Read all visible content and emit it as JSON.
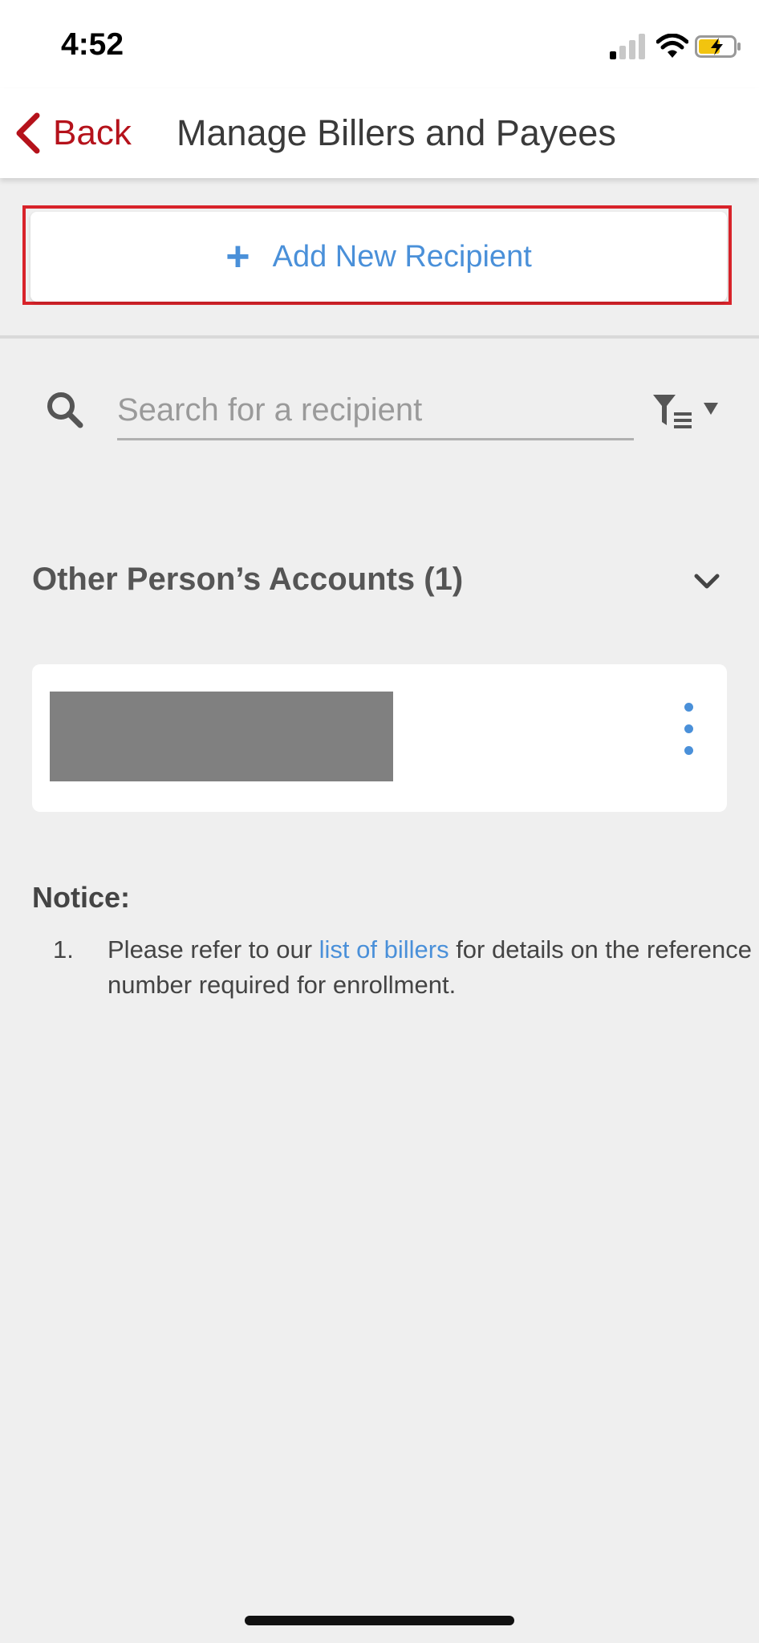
{
  "status_bar": {
    "time": "4:52"
  },
  "nav": {
    "back_label": "Back",
    "title": "Manage Billers and Payees"
  },
  "add_button": {
    "label": "Add New Recipient"
  },
  "search": {
    "placeholder": "Search for a recipient"
  },
  "section": {
    "title": "Other Person’s Accounts (1)"
  },
  "notice": {
    "title": "Notice:",
    "items": [
      {
        "number": "1.",
        "text_before": "Please refer to our ",
        "link": "list of billers",
        "text_after": " for details on the reference number required for enrollment."
      }
    ]
  },
  "colors": {
    "brand_red": "#b5121b",
    "accent_blue": "#4a90d9",
    "highlight_border": "#d8232a"
  },
  "icons": [
    "back-chevron-icon",
    "plus-icon",
    "search-icon",
    "filter-icon",
    "caret-down-icon",
    "chevron-down-icon",
    "kebab-menu-icon"
  ]
}
